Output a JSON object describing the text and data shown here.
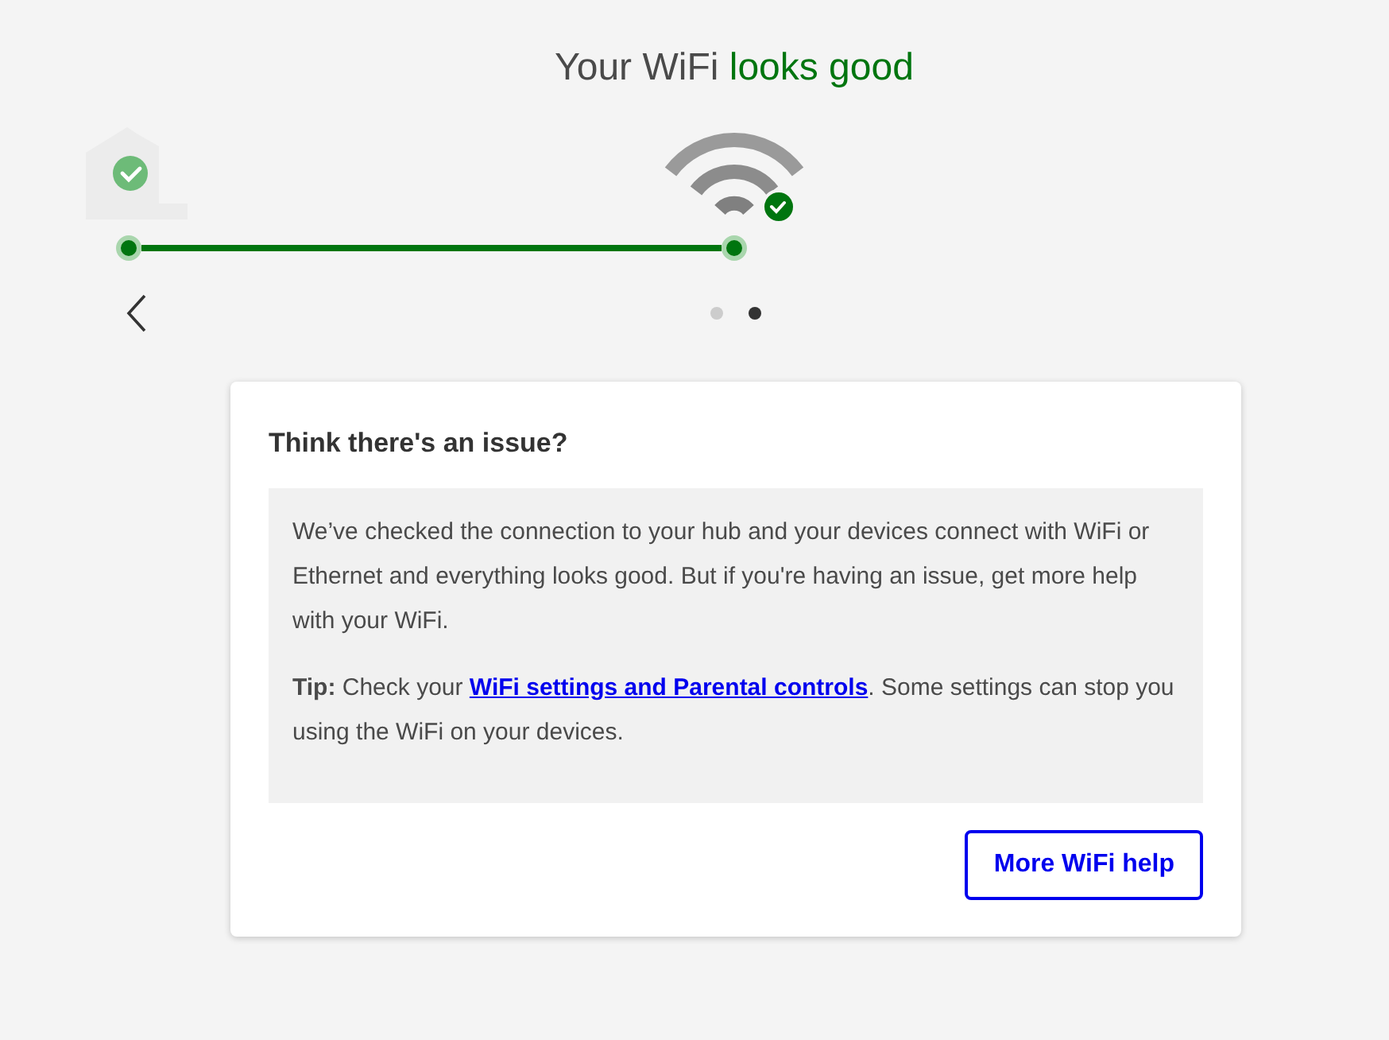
{
  "heading": {
    "text": "Your WiFi",
    "highlight": "looks good"
  },
  "progress": {
    "level": 1
  },
  "pager": [
    {
      "selected": false
    },
    {
      "selected": true
    }
  ],
  "card": {
    "title": "Think there's an issue?",
    "message": "We’ve checked the connection to your hub and your devices connect with WiFi or Ethernet and everything looks good. But if you're having an issue, get more help with your WiFi.",
    "tip": {
      "lead": "**Tip:** Check your ",
      "link": "WiFi settings and Parental controls",
      "after": ". Some settings can stop you using the WiFi on your devices."
    },
    "button": "More WiFi help"
  }
}
